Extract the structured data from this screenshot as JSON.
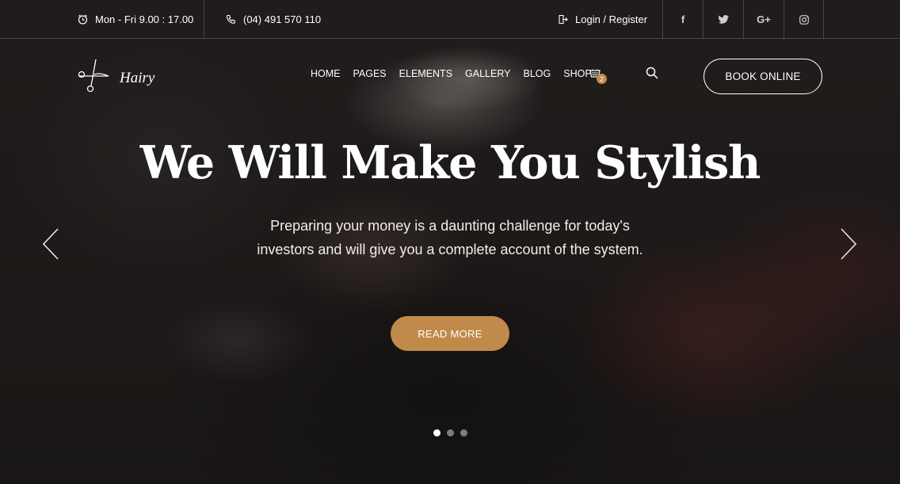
{
  "topbar": {
    "hours": "Mon - Fri 9.00 : 17.00",
    "phone": "(04) 491 570 110",
    "login": "Login / Register",
    "socials": [
      "facebook-icon",
      "twitter-icon",
      "google-plus-icon",
      "instagram-icon"
    ],
    "social_glyphs": {
      "facebook": "f",
      "google": "G+"
    }
  },
  "header": {
    "logo_text": "Hairy",
    "nav": [
      "HOME",
      "PAGES",
      "ELEMENTS",
      "GALLERY",
      "BLOG",
      "SHOP"
    ],
    "cart_count": "2",
    "book_button": "BOOK ONLINE"
  },
  "hero": {
    "title": "We Will Make You Stylish",
    "text": "Preparing your money is a daunting challenge for today's investors and will give you a complete account of the system.",
    "button": "READ MORE",
    "slides": 3,
    "active_slide": 1
  },
  "colors": {
    "accent": "#c08b4a"
  }
}
